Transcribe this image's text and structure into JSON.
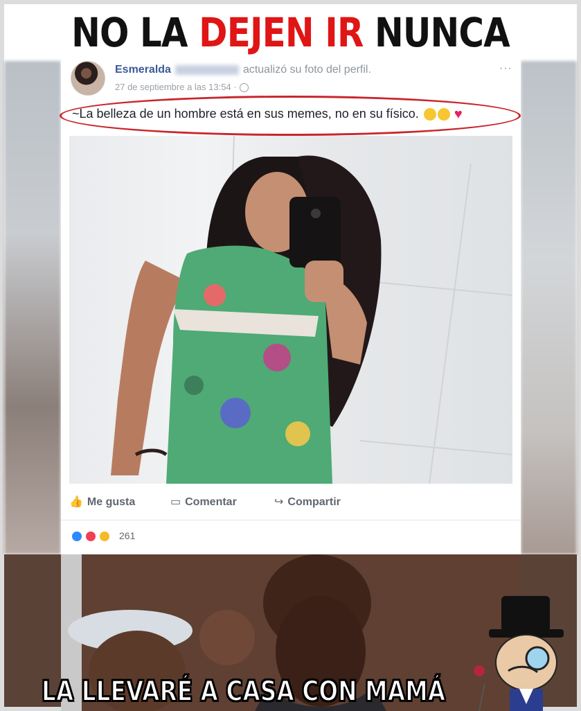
{
  "meme": {
    "top_text_a": "NO LA ",
    "top_text_b": "DEJEN IR",
    "top_text_c": " NUNCA",
    "bottom_text": "LA LLEVARÉ A CASA CON MAMÁ"
  },
  "post": {
    "author": "Esmeralda",
    "action_text": "actualizó su foto del perfil.",
    "timestamp": "27 de septiembre a las 13:54 ·",
    "more_label": "···",
    "caption": "~La belleza de un hombre está en sus memes, no en su físico.",
    "caption_heart": "♥"
  },
  "actions": {
    "like": "Me gusta",
    "comment": "Comentar",
    "share": "Compartir",
    "like_icon": "👍",
    "comment_icon": "▭",
    "share_icon": "↪"
  },
  "reactions": {
    "count": "261",
    "types": [
      "like",
      "love",
      "wow"
    ],
    "colors": {
      "like": "#2d88ff",
      "love": "#f33e58",
      "wow": "#f7b928"
    }
  },
  "icons": [
    "thumbs-up-icon",
    "comment-icon",
    "share-icon",
    "globe-icon",
    "more-icon",
    "heart-icon"
  ]
}
